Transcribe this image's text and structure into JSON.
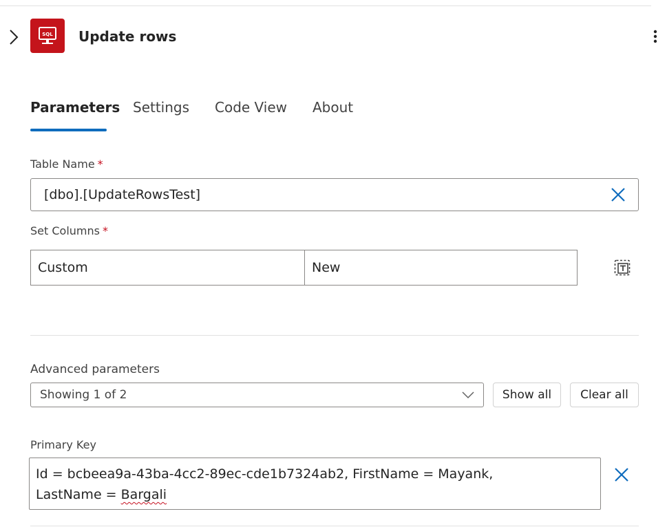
{
  "header": {
    "title": "Update rows",
    "app_icon_text": "SQL"
  },
  "tabs": [
    {
      "label": "Parameters",
      "active": true
    },
    {
      "label": "Settings",
      "active": false
    },
    {
      "label": "Code View",
      "active": false
    },
    {
      "label": "About",
      "active": false
    }
  ],
  "table_name": {
    "label": "Table Name",
    "required_mark": "*",
    "value": "[dbo].[UpdateRowsTest]"
  },
  "set_columns": {
    "label": "Set Columns",
    "required_mark": "*",
    "key": "Custom",
    "value": "New"
  },
  "advanced": {
    "label": "Advanced parameters",
    "dropdown_value": "Showing 1 of 2",
    "show_all_label": "Show all",
    "clear_all_label": "Clear all"
  },
  "primary_key": {
    "label": "Primary Key",
    "line1": "Id = bcbeea9a-43ba-4cc2-89ec-cde1b7324ab2, FirstName = Mayank,",
    "line2_prefix": "LastName = ",
    "line2_word": "Bargali"
  },
  "colors": {
    "accent": "#0f6cbd",
    "app_icon_bg": "#c4141b",
    "required": "#c50f1f"
  },
  "icons": [
    "chevron-right-icon",
    "sql-icon",
    "more-vertical-icon",
    "dismiss-icon",
    "text-mode-icon",
    "chevron-down-icon"
  ]
}
